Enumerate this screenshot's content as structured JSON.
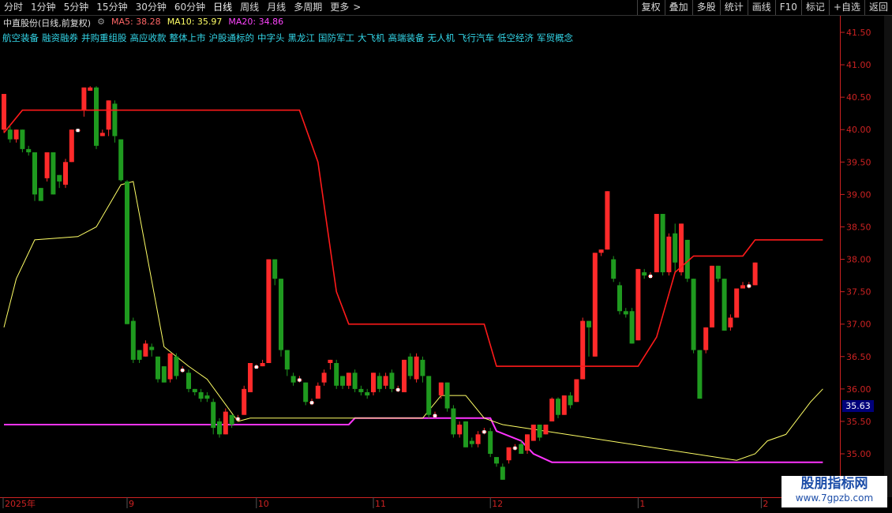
{
  "toolbar": {
    "periods": [
      "分时",
      "1分钟",
      "5分钟",
      "15分钟",
      "30分钟",
      "60分钟",
      "日线",
      "周线",
      "月线",
      "多周期",
      "更多"
    ],
    "more_arrow": ">",
    "buttons": [
      "复权",
      "叠加",
      "多股",
      "统计",
      "画线",
      "F10",
      "标记",
      "+自选",
      "返回"
    ]
  },
  "header": {
    "stock": "中直股份(日线,前复权)",
    "ma5_label": "MA5: 38.28",
    "ma10_label": "MA10: 35.97",
    "ma20_label": "MA20: 34.86"
  },
  "concepts": [
    "航空装备",
    "融资融券",
    "并购重组股",
    "高应收款",
    "整体上市",
    "沪股通标的",
    "中字头",
    "黑龙江",
    "国防军工",
    "大飞机",
    "高端装备",
    "无人机",
    "飞行汽车",
    "低空经济",
    "军贸概念"
  ],
  "price_tag": "35.63",
  "watermark": {
    "line1": "股朋指标网",
    "line2": "www.7gpzb.com"
  },
  "colors": {
    "up": "#ff2a2a",
    "down": "#1f9a1f",
    "ma5": "#ffffff",
    "ma10": "#ffff66",
    "ma20": "#ff33ff",
    "stop_line": "#ff1a1a",
    "concept_text": "#33d6e8",
    "axis": "#cc2222"
  },
  "chart_data": {
    "type": "candlestick",
    "y_ticks": [
      "41.50",
      "41.00",
      "40.50",
      "40.00",
      "39.50",
      "39.00",
      "38.50",
      "38.00",
      "37.50",
      "37.00",
      "36.50",
      "36.00",
      "35.50",
      "35.00"
    ],
    "ylim": [
      34.3,
      41.7
    ],
    "x_labels": [
      "2025年",
      "9",
      "10",
      "11",
      "12",
      "1",
      "2"
    ],
    "x_label_index": [
      0,
      20,
      41,
      60,
      79,
      103,
      123
    ],
    "candles": [
      {
        "o": 40.0,
        "c": 40.55,
        "h": 40.55,
        "l": 39.95
      },
      {
        "o": 40.0,
        "c": 39.85,
        "h": 40.05,
        "l": 39.8
      },
      {
        "o": 39.85,
        "c": 40.0,
        "h": 40.0,
        "l": 39.8
      },
      {
        "o": 40.0,
        "c": 39.7,
        "h": 40.0,
        "l": 39.65
      },
      {
        "o": 39.7,
        "c": 39.65,
        "h": 39.75,
        "l": 39.6
      },
      {
        "o": 39.65,
        "c": 39.0,
        "h": 39.65,
        "l": 38.9
      },
      {
        "o": 39.1,
        "c": 38.9,
        "h": 39.1,
        "l": 38.9
      },
      {
        "o": 39.25,
        "c": 39.65,
        "h": 39.65,
        "l": 39.2
      },
      {
        "o": 39.65,
        "c": 39.0,
        "h": 39.65,
        "l": 39.0
      },
      {
        "o": 39.3,
        "c": 39.2,
        "h": 39.3,
        "l": 39.1
      },
      {
        "o": 39.15,
        "c": 39.5,
        "h": 39.55,
        "l": 39.1
      },
      {
        "o": 39.5,
        "c": 40.0,
        "h": 40.0,
        "l": 39.5
      },
      {
        "o": 40.0,
        "c": 40.0,
        "h": 40.0,
        "l": 40.0
      },
      {
        "o": 40.3,
        "c": 40.65,
        "h": 40.65,
        "l": 40.2
      },
      {
        "o": 40.6,
        "c": 40.65,
        "h": 40.67,
        "l": 40.6
      },
      {
        "o": 40.65,
        "c": 39.75,
        "h": 40.67,
        "l": 39.7
      },
      {
        "o": 39.9,
        "c": 39.95,
        "h": 40.0,
        "l": 39.9
      },
      {
        "o": 40.0,
        "c": 40.45,
        "h": 40.45,
        "l": 39.9
      },
      {
        "o": 40.4,
        "c": 39.9,
        "h": 40.45,
        "l": 39.8
      },
      {
        "o": 39.85,
        "c": 39.22,
        "h": 39.85,
        "l": 39.2
      },
      {
        "o": 39.2,
        "c": 37.0,
        "h": 39.22,
        "l": 37.0
      },
      {
        "o": 37.05,
        "c": 36.45,
        "h": 37.1,
        "l": 36.4
      },
      {
        "o": 36.6,
        "c": 36.45,
        "h": 36.6,
        "l": 36.4
      },
      {
        "o": 36.5,
        "c": 36.7,
        "h": 36.75,
        "l": 36.5
      },
      {
        "o": 36.65,
        "c": 36.6,
        "h": 36.7,
        "l": 36.5
      },
      {
        "o": 36.5,
        "c": 36.15,
        "h": 36.5,
        "l": 36.1
      },
      {
        "o": 36.35,
        "c": 36.1,
        "h": 36.35,
        "l": 36.1
      },
      {
        "o": 36.15,
        "c": 36.55,
        "h": 36.55,
        "l": 36.1
      },
      {
        "o": 36.5,
        "c": 36.2,
        "h": 36.55,
        "l": 36.15
      },
      {
        "o": 36.3,
        "c": 36.3,
        "h": 36.35,
        "l": 36.25
      },
      {
        "o": 36.25,
        "c": 36.0,
        "h": 36.3,
        "l": 35.95
      },
      {
        "o": 36.0,
        "c": 35.95,
        "h": 36.0,
        "l": 35.9
      },
      {
        "o": 35.95,
        "c": 35.85,
        "h": 36.0,
        "l": 35.8
      },
      {
        "o": 35.9,
        "c": 35.85,
        "h": 35.95,
        "l": 35.8
      },
      {
        "o": 35.8,
        "c": 35.4,
        "h": 35.85,
        "l": 35.3
      },
      {
        "o": 35.5,
        "c": 35.3,
        "h": 35.55,
        "l": 35.25
      },
      {
        "o": 35.3,
        "c": 35.65,
        "h": 35.7,
        "l": 35.3
      },
      {
        "o": 35.6,
        "c": 35.45,
        "h": 35.6,
        "l": 35.4
      },
      {
        "o": 35.55,
        "c": 35.55,
        "h": 35.6,
        "l": 35.5
      },
      {
        "o": 35.6,
        "c": 36.0,
        "h": 36.05,
        "l": 35.6
      },
      {
        "o": 35.95,
        "c": 36.4,
        "h": 36.4,
        "l": 35.95
      },
      {
        "o": 36.35,
        "c": 36.35,
        "h": 36.38,
        "l": 36.33
      },
      {
        "o": 36.35,
        "c": 36.4,
        "h": 36.45,
        "l": 36.35
      },
      {
        "o": 36.4,
        "c": 38.0,
        "h": 38.0,
        "l": 36.4
      },
      {
        "o": 38.0,
        "c": 37.7,
        "h": 38.0,
        "l": 37.6
      },
      {
        "o": 37.7,
        "c": 36.6,
        "h": 37.7,
        "l": 36.5
      },
      {
        "o": 36.6,
        "c": 36.3,
        "h": 36.6,
        "l": 36.2
      },
      {
        "o": 36.2,
        "c": 36.1,
        "h": 36.25,
        "l": 36.05
      },
      {
        "o": 36.15,
        "c": 36.15,
        "h": 36.2,
        "l": 36.1
      },
      {
        "o": 36.1,
        "c": 35.8,
        "h": 36.1,
        "l": 35.75
      },
      {
        "o": 35.8,
        "c": 35.8,
        "h": 35.85,
        "l": 35.75
      },
      {
        "o": 35.85,
        "c": 36.05,
        "h": 36.1,
        "l": 35.85
      },
      {
        "o": 36.1,
        "c": 36.25,
        "h": 36.3,
        "l": 36.05
      },
      {
        "o": 36.4,
        "c": 36.45,
        "h": 36.45,
        "l": 36.3
      },
      {
        "o": 36.4,
        "c": 36.05,
        "h": 36.45,
        "l": 36.0
      },
      {
        "o": 36.2,
        "c": 36.05,
        "h": 36.2,
        "l": 36.0
      },
      {
        "o": 36.05,
        "c": 36.25,
        "h": 36.25,
        "l": 36.0
      },
      {
        "o": 36.25,
        "c": 36.0,
        "h": 36.3,
        "l": 35.95
      },
      {
        "o": 36.0,
        "c": 35.95,
        "h": 36.05,
        "l": 35.9
      },
      {
        "o": 35.95,
        "c": 35.9,
        "h": 36.0,
        "l": 35.85
      },
      {
        "o": 35.95,
        "c": 36.25,
        "h": 36.25,
        "l": 35.9
      },
      {
        "o": 36.2,
        "c": 36.0,
        "h": 36.25,
        "l": 35.95
      },
      {
        "o": 36.05,
        "c": 36.2,
        "h": 36.25,
        "l": 36.0
      },
      {
        "o": 36.25,
        "c": 36.0,
        "h": 36.3,
        "l": 35.95
      },
      {
        "o": 36.0,
        "c": 36.0,
        "h": 36.05,
        "l": 35.95
      },
      {
        "o": 35.95,
        "c": 36.45,
        "h": 36.45,
        "l": 35.95
      },
      {
        "o": 36.5,
        "c": 36.2,
        "h": 36.55,
        "l": 36.15
      },
      {
        "o": 36.15,
        "c": 36.5,
        "h": 36.55,
        "l": 36.1
      },
      {
        "o": 36.45,
        "c": 36.2,
        "h": 36.5,
        "l": 36.1
      },
      {
        "o": 36.2,
        "c": 35.6,
        "h": 36.2,
        "l": 35.55
      },
      {
        "o": 35.6,
        "c": 35.6,
        "h": 35.65,
        "l": 35.55
      },
      {
        "o": 35.9,
        "c": 36.1,
        "h": 36.1,
        "l": 35.85
      },
      {
        "o": 36.1,
        "c": 35.7,
        "h": 36.1,
        "l": 35.65
      },
      {
        "o": 35.7,
        "c": 35.3,
        "h": 35.75,
        "l": 35.25
      },
      {
        "o": 35.3,
        "c": 35.45,
        "h": 35.5,
        "l": 35.25
      },
      {
        "o": 35.5,
        "c": 35.1,
        "h": 35.5,
        "l": 35.1
      },
      {
        "o": 35.2,
        "c": 35.15,
        "h": 35.25,
        "l": 35.1
      },
      {
        "o": 35.15,
        "c": 35.3,
        "h": 35.35,
        "l": 35.1
      },
      {
        "o": 35.35,
        "c": 35.35,
        "h": 35.4,
        "l": 35.3
      },
      {
        "o": 35.35,
        "c": 35.0,
        "h": 35.4,
        "l": 34.95
      },
      {
        "o": 34.95,
        "c": 34.85,
        "h": 34.95,
        "l": 34.8
      },
      {
        "o": 34.8,
        "c": 34.6,
        "h": 34.85,
        "l": 34.6
      },
      {
        "o": 34.9,
        "c": 35.1,
        "h": 35.1,
        "l": 34.85
      },
      {
        "o": 35.1,
        "c": 35.1,
        "h": 35.15,
        "l": 35.05
      },
      {
        "o": 35.15,
        "c": 35.0,
        "h": 35.2,
        "l": 35.0
      },
      {
        "o": 35.05,
        "c": 35.3,
        "h": 35.3,
        "l": 35.0
      },
      {
        "o": 35.2,
        "c": 35.45,
        "h": 35.45,
        "l": 35.2
      },
      {
        "o": 35.45,
        "c": 35.25,
        "h": 35.45,
        "l": 35.2
      },
      {
        "o": 35.3,
        "c": 35.45,
        "h": 35.45,
        "l": 35.3
      },
      {
        "o": 35.5,
        "c": 35.85,
        "h": 35.87,
        "l": 35.5
      },
      {
        "o": 35.85,
        "c": 35.6,
        "h": 35.87,
        "l": 35.55
      },
      {
        "o": 35.6,
        "c": 35.9,
        "h": 35.9,
        "l": 35.6
      },
      {
        "o": 35.9,
        "c": 35.75,
        "h": 35.95,
        "l": 35.7
      },
      {
        "o": 35.8,
        "c": 36.15,
        "h": 36.15,
        "l": 35.8
      },
      {
        "o": 36.15,
        "c": 37.05,
        "h": 37.1,
        "l": 36.15
      },
      {
        "o": 37.05,
        "c": 36.95,
        "h": 37.05,
        "l": 36.5
      },
      {
        "o": 36.5,
        "c": 38.1,
        "h": 38.1,
        "l": 36.5
      },
      {
        "o": 38.1,
        "c": 38.15,
        "h": 38.15,
        "l": 38.05
      },
      {
        "o": 38.15,
        "c": 39.05,
        "h": 39.05,
        "l": 38.15
      },
      {
        "o": 38.0,
        "c": 37.7,
        "h": 38.05,
        "l": 37.65
      },
      {
        "o": 37.6,
        "c": 37.2,
        "h": 37.65,
        "l": 37.15
      },
      {
        "o": 37.2,
        "c": 37.15,
        "h": 37.25,
        "l": 37.1
      },
      {
        "o": 37.2,
        "c": 36.7,
        "h": 37.25,
        "l": 36.7
      },
      {
        "o": 36.75,
        "c": 37.85,
        "h": 37.85,
        "l": 36.75
      },
      {
        "o": 37.8,
        "c": 37.75,
        "h": 37.85,
        "l": 37.7
      },
      {
        "o": 37.75,
        "c": 37.75,
        "h": 37.8,
        "l": 37.7
      },
      {
        "o": 37.8,
        "c": 38.7,
        "h": 38.7,
        "l": 37.8
      },
      {
        "o": 38.7,
        "c": 37.8,
        "h": 38.7,
        "l": 37.75
      },
      {
        "o": 37.8,
        "c": 38.35,
        "h": 38.4,
        "l": 37.75
      },
      {
        "o": 38.4,
        "c": 37.95,
        "h": 38.55,
        "l": 37.8
      },
      {
        "o": 37.8,
        "c": 38.55,
        "h": 38.55,
        "l": 37.75
      },
      {
        "o": 38.3,
        "c": 37.7,
        "h": 38.3,
        "l": 37.65
      },
      {
        "o": 37.7,
        "c": 36.6,
        "h": 37.7,
        "l": 36.55
      },
      {
        "o": 36.6,
        "c": 35.85,
        "h": 36.6,
        "l": 35.85
      },
      {
        "o": 36.6,
        "c": 36.95,
        "h": 36.95,
        "l": 36.55
      },
      {
        "o": 36.95,
        "c": 37.9,
        "h": 37.9,
        "l": 36.95
      },
      {
        "o": 37.9,
        "c": 37.7,
        "h": 37.9,
        "l": 37.65
      },
      {
        "o": 37.7,
        "c": 36.9,
        "h": 37.7,
        "l": 36.9
      },
      {
        "o": 36.95,
        "c": 37.1,
        "h": 37.15,
        "l": 36.9
      },
      {
        "o": 37.1,
        "c": 37.55,
        "h": 37.55,
        "l": 37.1
      },
      {
        "o": 37.55,
        "c": 37.6,
        "h": 37.65,
        "l": 37.55
      },
      {
        "o": 37.6,
        "c": 37.6,
        "h": 37.65,
        "l": 37.55
      },
      {
        "o": 37.6,
        "c": 37.95,
        "h": 37.95,
        "l": 37.6
      }
    ],
    "red_line": [
      [
        0,
        39.95
      ],
      [
        3,
        40.3
      ],
      [
        20,
        40.3
      ],
      [
        48,
        40.3
      ],
      [
        51,
        39.5
      ],
      [
        54,
        37.5
      ],
      [
        56,
        37.0
      ],
      [
        78,
        37.0
      ],
      [
        80,
        36.35
      ],
      [
        103,
        36.35
      ],
      [
        106,
        36.8
      ],
      [
        109,
        37.8
      ],
      [
        112,
        38.05
      ],
      [
        120,
        38.05
      ],
      [
        122,
        38.3
      ],
      [
        133,
        38.3
      ]
    ],
    "yellow_line": [
      [
        0,
        36.95
      ],
      [
        2,
        37.7
      ],
      [
        5,
        38.3
      ],
      [
        12,
        38.35
      ],
      [
        15,
        38.5
      ],
      [
        19,
        39.15
      ],
      [
        21,
        39.2
      ],
      [
        26,
        36.65
      ],
      [
        30,
        36.35
      ],
      [
        33,
        36.15
      ],
      [
        38,
        35.5
      ],
      [
        40,
        35.55
      ],
      [
        56,
        35.55
      ],
      [
        68,
        35.55
      ],
      [
        71,
        35.9
      ],
      [
        75,
        35.9
      ],
      [
        78,
        35.55
      ],
      [
        81,
        35.45
      ],
      [
        119,
        34.9
      ],
      [
        122,
        35.0
      ],
      [
        124,
        35.2
      ],
      [
        127,
        35.3
      ],
      [
        131,
        35.8
      ],
      [
        133,
        36.0
      ]
    ],
    "magenta_line": [
      [
        0,
        35.45
      ],
      [
        56,
        35.45
      ],
      [
        57,
        35.55
      ],
      [
        79,
        35.55
      ],
      [
        80,
        35.35
      ],
      [
        84,
        35.2
      ],
      [
        86,
        35.0
      ],
      [
        89,
        34.87
      ],
      [
        133,
        34.87
      ]
    ]
  }
}
